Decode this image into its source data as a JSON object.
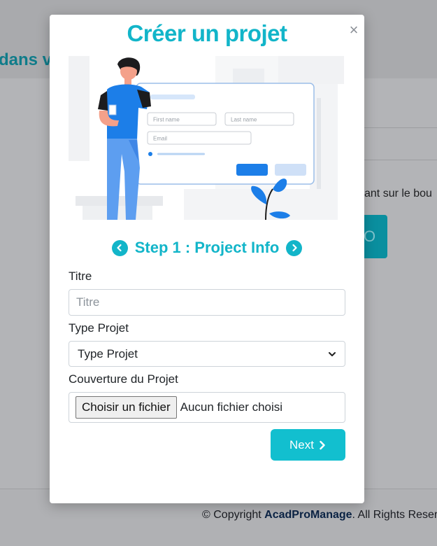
{
  "background": {
    "heading": "dans v",
    "partial_text": "ant sur le bou",
    "button_glyph": "O",
    "footer_prefix": "© Copyright",
    "footer_brand": "AcadProManage",
    "footer_suffix": ". All Rights Reserv"
  },
  "modal": {
    "title": "Créer un projet",
    "close_glyph": "×",
    "illustration": {
      "first_name_placeholder": "First name",
      "last_name_placeholder": "Last name",
      "email_placeholder": "Email"
    },
    "step": {
      "label": "Step 1 : Project Info"
    },
    "form": {
      "title_label": "Titre",
      "title_placeholder": "Titre",
      "title_value": "",
      "type_label": "Type Projet",
      "type_selected": "Type Projet",
      "cover_label": "Couverture du Projet",
      "file_button": "Choisir un fichier",
      "file_status": "Aucun fichier choisi"
    },
    "next_label": "Next"
  },
  "colors": {
    "accent": "#12b5c9",
    "next_button": "#12bfcf",
    "overlay": "#b0b1b4"
  }
}
